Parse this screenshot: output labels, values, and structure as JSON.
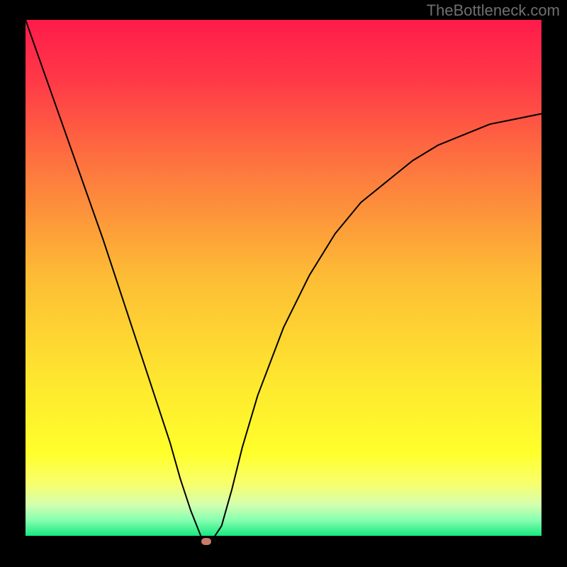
{
  "watermark": "TheBottleneck.com",
  "chart_data": {
    "type": "line",
    "title": "",
    "xlabel": "",
    "ylabel": "",
    "xlim": [
      0,
      100
    ],
    "ylim": [
      0,
      100
    ],
    "grid": false,
    "gradient_stops": [
      {
        "pos": 0.0,
        "color": "#ff1b4b"
      },
      {
        "pos": 0.12,
        "color": "#ff3a47"
      },
      {
        "pos": 0.3,
        "color": "#fd7b3e"
      },
      {
        "pos": 0.5,
        "color": "#fdbd35"
      },
      {
        "pos": 0.7,
        "color": "#fee72f"
      },
      {
        "pos": 0.84,
        "color": "#ffff2b"
      },
      {
        "pos": 0.9,
        "color": "#f8ff6e"
      },
      {
        "pos": 0.94,
        "color": "#d3ffb0"
      },
      {
        "pos": 0.97,
        "color": "#86ffb0"
      },
      {
        "pos": 1.0,
        "color": "#17e87e"
      }
    ],
    "series": [
      {
        "name": "bottleneck-curve",
        "x": [
          0,
          5,
          10,
          15,
          20,
          25,
          28,
          30,
          32,
          34,
          35,
          36,
          38,
          40,
          42,
          45,
          50,
          55,
          60,
          65,
          70,
          75,
          80,
          85,
          90,
          95,
          100
        ],
        "y": [
          100,
          86,
          72,
          58,
          43,
          28,
          19,
          12,
          6,
          1,
          0,
          0,
          3,
          10,
          18,
          28,
          41,
          51,
          59,
          65,
          69,
          73,
          76,
          78,
          80,
          81,
          82
        ]
      }
    ],
    "marker": {
      "x": 35,
      "y": 0,
      "color": "#cb7b6a"
    }
  }
}
